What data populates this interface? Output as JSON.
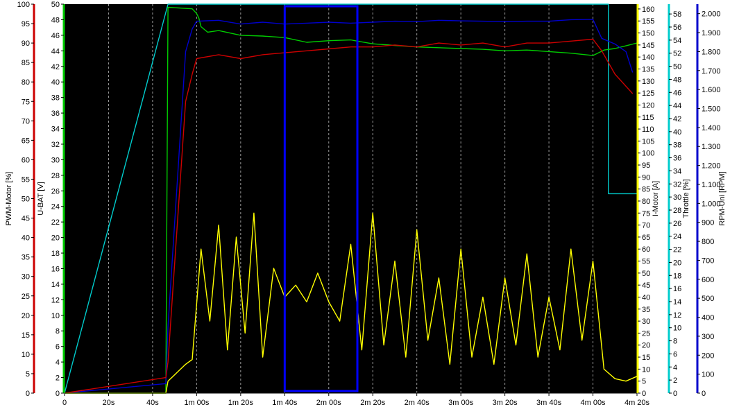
{
  "chart_data": {
    "type": "line",
    "background": "#000000",
    "grid": "vertical dashed",
    "x_axis": {
      "range_seconds": [
        0,
        260
      ],
      "tick_labels": [
        "0",
        "20s",
        "40s",
        "1m 00s",
        "1m 20s",
        "1m 40s",
        "2m 00s",
        "2m 20s",
        "2m 40s",
        "3m 00s",
        "3m 20s",
        "3m 40s",
        "4m 00s",
        "4m 20s"
      ]
    },
    "y_axes": [
      {
        "id": "pwm",
        "label": "PWM-Motor [%]",
        "color": "#cc0000",
        "side": "left",
        "range": [
          0,
          100
        ],
        "ticks": [
          "0",
          "5",
          "10",
          "15",
          "20",
          "25",
          "30",
          "35",
          "40",
          "45",
          "50",
          "55",
          "60",
          "65",
          "70",
          "75",
          "80",
          "85",
          "90",
          "95",
          "100"
        ]
      },
      {
        "id": "ubat",
        "label": "U-BAT [V]",
        "color": "#00cc00",
        "side": "left",
        "range": [
          0,
          50
        ],
        "ticks": [
          "0",
          "2",
          "4",
          "6",
          "8",
          "10",
          "12",
          "14",
          "16",
          "18",
          "20",
          "22",
          "24",
          "26",
          "28",
          "30",
          "32",
          "34",
          "36",
          "38",
          "40",
          "42",
          "44",
          "46",
          "48",
          "50"
        ]
      },
      {
        "id": "imotor",
        "label": "I-Motor [A]",
        "color": "#ffff00",
        "side": "right",
        "range": [
          0,
          162
        ],
        "ticks": [
          "0",
          "5",
          "10",
          "15",
          "20",
          "25",
          "30",
          "35",
          "40",
          "45",
          "50",
          "55",
          "60",
          "65",
          "70",
          "75",
          "80",
          "85",
          "90",
          "95",
          "100",
          "105",
          "110",
          "115",
          "120",
          "125",
          "130",
          "135",
          "140",
          "145",
          "150",
          "155",
          "160"
        ]
      },
      {
        "id": "throttle",
        "label": "Throttle [%]",
        "color": "#00cccc",
        "side": "right",
        "range": [
          0,
          59.5
        ],
        "ticks": [
          "0",
          "2",
          "4",
          "6",
          "8",
          "10",
          "12",
          "14",
          "16",
          "18",
          "20",
          "22",
          "24",
          "26",
          "28",
          "30",
          "32",
          "34",
          "36",
          "38",
          "40",
          "42",
          "44",
          "46",
          "48",
          "50",
          "52",
          "54",
          "56",
          "58"
        ]
      },
      {
        "id": "rpm",
        "label": "RPM-Uni [RPM]",
        "color": "#0000cc",
        "side": "right",
        "range": [
          0,
          2050
        ],
        "ticks": [
          "0",
          "100",
          "200",
          "300",
          "400",
          "500",
          "600",
          "700",
          "800",
          "900",
          "1.000",
          "1.100",
          "1.200",
          "1.300",
          "1.400",
          "1.500",
          "1.600",
          "1.700",
          "1.800",
          "1.900",
          "2.000"
        ]
      }
    ],
    "series": [
      {
        "axis": "throttle",
        "color": "#00cccc",
        "points": [
          [
            0,
            0
          ],
          [
            47,
            59.5
          ],
          [
            247,
            59.5
          ],
          [
            247,
            30.5
          ],
          [
            260,
            30.5
          ]
        ]
      },
      {
        "axis": "ubat",
        "color": "#00cc00",
        "points": [
          [
            0,
            0
          ],
          [
            46,
            0
          ],
          [
            47,
            49.6
          ],
          [
            58,
            49.4
          ],
          [
            60,
            48.8
          ],
          [
            61,
            48.2
          ],
          [
            62,
            47.1
          ],
          [
            65,
            46.4
          ],
          [
            70,
            46.6
          ],
          [
            80,
            46.0
          ],
          [
            90,
            45.9
          ],
          [
            100,
            45.7
          ],
          [
            110,
            45.1
          ],
          [
            120,
            45.3
          ],
          [
            130,
            45.4
          ],
          [
            140,
            44.9
          ],
          [
            150,
            44.7
          ],
          [
            160,
            44.5
          ],
          [
            170,
            44.4
          ],
          [
            180,
            44.3
          ],
          [
            190,
            44.2
          ],
          [
            200,
            44.0
          ],
          [
            210,
            44.1
          ],
          [
            220,
            43.9
          ],
          [
            230,
            43.7
          ],
          [
            240,
            43.4
          ],
          [
            245,
            44.1
          ],
          [
            250,
            44.3
          ],
          [
            260,
            45.0
          ]
        ]
      },
      {
        "axis": "rpm",
        "color": "#0000cc",
        "points": [
          [
            0,
            0
          ],
          [
            46,
            50
          ],
          [
            47,
            350
          ],
          [
            55,
            1800
          ],
          [
            58,
            1920
          ],
          [
            60,
            1960
          ],
          [
            70,
            1965
          ],
          [
            80,
            1945
          ],
          [
            90,
            1955
          ],
          [
            100,
            1945
          ],
          [
            110,
            1950
          ],
          [
            120,
            1955
          ],
          [
            130,
            1950
          ],
          [
            140,
            1955
          ],
          [
            150,
            1960
          ],
          [
            160,
            1958
          ],
          [
            170,
            1965
          ],
          [
            180,
            1962
          ],
          [
            190,
            1960
          ],
          [
            200,
            1958
          ],
          [
            210,
            1960
          ],
          [
            220,
            1960
          ],
          [
            230,
            1968
          ],
          [
            240,
            1970
          ],
          [
            244,
            1870
          ],
          [
            250,
            1840
          ],
          [
            255,
            1800
          ],
          [
            258,
            1690
          ]
        ]
      },
      {
        "axis": "pwm",
        "color": "#cc0000",
        "points": [
          [
            0,
            0
          ],
          [
            46,
            4
          ],
          [
            47,
            8
          ],
          [
            55,
            75
          ],
          [
            58,
            82
          ],
          [
            60,
            86
          ],
          [
            70,
            87
          ],
          [
            80,
            86
          ],
          [
            90,
            87
          ],
          [
            100,
            87.5
          ],
          [
            110,
            88
          ],
          [
            120,
            88.5
          ],
          [
            130,
            89
          ],
          [
            140,
            89
          ],
          [
            150,
            89.5
          ],
          [
            160,
            89
          ],
          [
            170,
            90
          ],
          [
            180,
            89.5
          ],
          [
            190,
            90
          ],
          [
            200,
            89
          ],
          [
            210,
            90
          ],
          [
            220,
            90
          ],
          [
            230,
            90.5
          ],
          [
            240,
            91
          ],
          [
            244,
            88
          ],
          [
            250,
            82
          ],
          [
            258,
            77
          ]
        ]
      },
      {
        "axis": "imotor",
        "color": "#ffff00",
        "points": [
          [
            0,
            0
          ],
          [
            46,
            0
          ],
          [
            47,
            5
          ],
          [
            55,
            12
          ],
          [
            58,
            14
          ],
          [
            62,
            60
          ],
          [
            66,
            30
          ],
          [
            70,
            70
          ],
          [
            74,
            18
          ],
          [
            78,
            65
          ],
          [
            82,
            25
          ],
          [
            86,
            75
          ],
          [
            90,
            15
          ],
          [
            95,
            52
          ],
          [
            100,
            40
          ],
          [
            105,
            45
          ],
          [
            110,
            38
          ],
          [
            115,
            50
          ],
          [
            120,
            38
          ],
          [
            125,
            30
          ],
          [
            130,
            62
          ],
          [
            135,
            18
          ],
          [
            140,
            75
          ],
          [
            145,
            20
          ],
          [
            150,
            55
          ],
          [
            155,
            15
          ],
          [
            160,
            68
          ],
          [
            165,
            22
          ],
          [
            170,
            48
          ],
          [
            175,
            12
          ],
          [
            180,
            60
          ],
          [
            185,
            15
          ],
          [
            190,
            40
          ],
          [
            195,
            12
          ],
          [
            200,
            48
          ],
          [
            205,
            20
          ],
          [
            210,
            58
          ],
          [
            215,
            15
          ],
          [
            220,
            40
          ],
          [
            225,
            18
          ],
          [
            230,
            60
          ],
          [
            235,
            22
          ],
          [
            240,
            55
          ],
          [
            245,
            10
          ],
          [
            250,
            6
          ],
          [
            255,
            5
          ],
          [
            260,
            7
          ]
        ]
      }
    ],
    "selection": {
      "x_range_seconds": [
        100,
        133
      ],
      "color": "#0000ff"
    }
  }
}
